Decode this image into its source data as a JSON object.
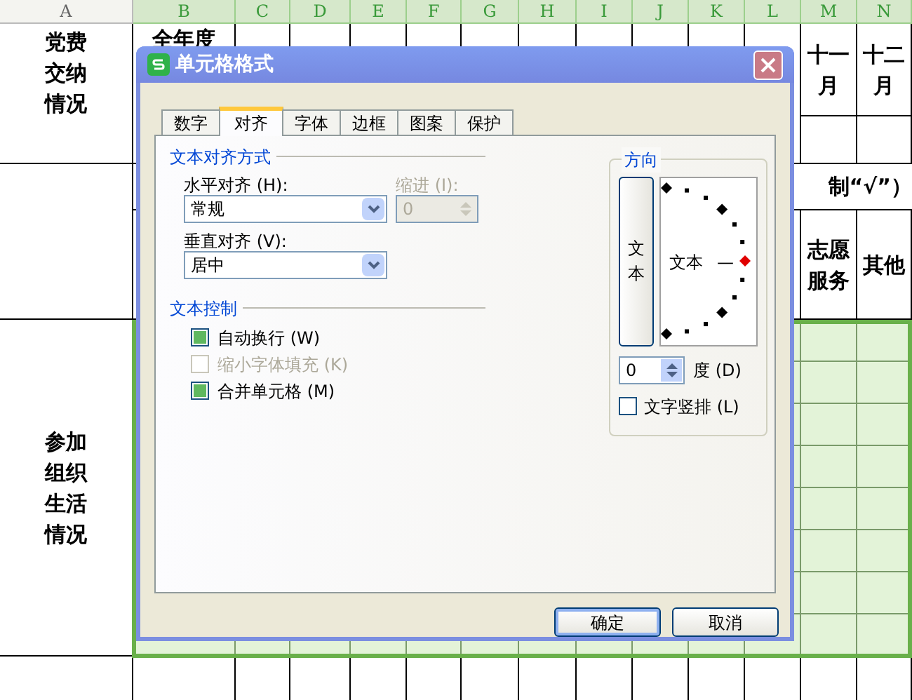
{
  "sheet": {
    "columns": [
      "A",
      "B",
      "C",
      "D",
      "E",
      "F",
      "G",
      "H",
      "I",
      "J",
      "K",
      "L",
      "M",
      "N"
    ],
    "party_fee_label": [
      "党费",
      "交纳",
      "情况"
    ],
    "annual_fee_label": [
      "全年度"
    ],
    "months": [
      [
        "十一",
        "月"
      ],
      [
        "十二",
        "月"
      ]
    ],
    "tick_note": "制“√”）",
    "activity_headers": [
      [
        "志愿",
        "服务"
      ],
      [
        "其他"
      ]
    ],
    "org_life_label": [
      "参加",
      "组织",
      "生活",
      "情况"
    ]
  },
  "dialog": {
    "title": "单元格格式",
    "tabs": [
      {
        "label": "数字",
        "selected": false
      },
      {
        "label": "对齐",
        "selected": true
      },
      {
        "label": "字体",
        "selected": false
      },
      {
        "label": "边框",
        "selected": false
      },
      {
        "label": "图案",
        "selected": false
      },
      {
        "label": "保护",
        "selected": false
      }
    ],
    "alignment": {
      "title": "文本对齐方式",
      "horizontal_label": "水平对齐 (H):",
      "horizontal_value": "常规",
      "indent_label": "缩进 (I):",
      "indent_value": "0",
      "indent_disabled": true,
      "vertical_label": "垂直对齐 (V):",
      "vertical_value": "居中"
    },
    "text_control": {
      "title": "文本控制",
      "options": [
        {
          "label": "自动换行 (W)",
          "checked": true,
          "disabled": false
        },
        {
          "label": "缩小字体填充 (K)",
          "checked": false,
          "disabled": true
        },
        {
          "label": "合并单元格 (M)",
          "checked": true,
          "disabled": false
        }
      ]
    },
    "orientation": {
      "title": "方向",
      "vertical_button": "文本",
      "dial_text": "文本",
      "dial_dash": "—",
      "degrees_value": "0",
      "degrees_label": "度 (D)",
      "vertical_text": {
        "label": "文字竖排 (L)",
        "checked": false
      }
    },
    "buttons": [
      "确定",
      "取消"
    ]
  }
}
